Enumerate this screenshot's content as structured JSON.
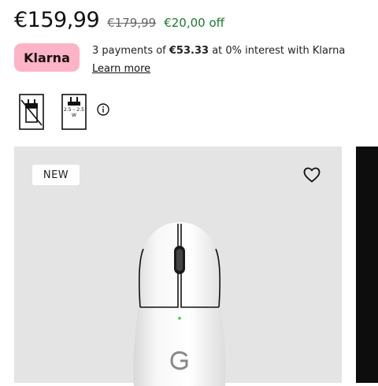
{
  "price": {
    "current": "€159,99",
    "original": "€179,99",
    "discount": "€20,00 off"
  },
  "klarna": {
    "logo_text": "Klarna",
    "installments_prefix": "3 payments of ",
    "installment_amount": "€53.33",
    "installments_suffix": " at 0% interest with Klarna",
    "learn_more": "Learn more",
    "brand_color": "#ffb3c7"
  },
  "energy": {
    "icons": [
      "no-charger-included-icon",
      "charger-power-icon",
      "info-icon"
    ],
    "power_range": "2.5 – 2.5",
    "power_unit": "W"
  },
  "product": {
    "badge": "NEW",
    "wishlist_icon": "heart-icon",
    "image": "white wireless gaming mouse",
    "card_color": "#e4e4e4"
  }
}
